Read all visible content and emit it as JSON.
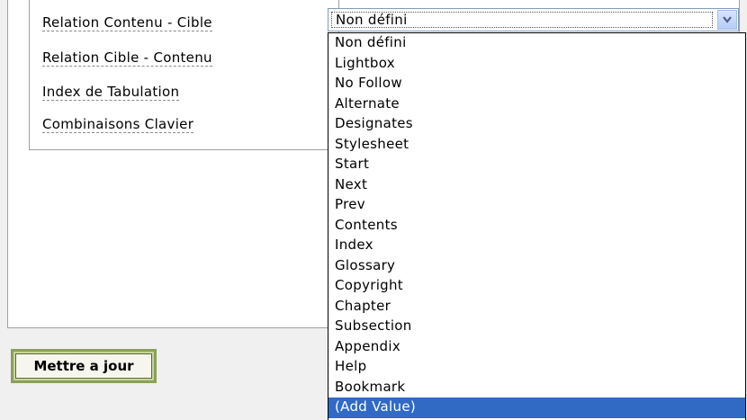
{
  "fields": [
    {
      "label": "Relation Contenu - Cible"
    },
    {
      "label": "Relation Cible - Contenu"
    },
    {
      "label": "Index de Tabulation"
    },
    {
      "label": "Combinaisons Clavier"
    }
  ],
  "select": {
    "value": "Non défini",
    "arrow_icon": "chevron-down-icon",
    "options": [
      "Non défini",
      "Lightbox",
      "No Follow",
      "Alternate",
      "Designates",
      "Stylesheet",
      "Start",
      "Next",
      "Prev",
      "Contents",
      "Index",
      "Glossary",
      "Copyright",
      "Chapter",
      "Subsection",
      "Appendix",
      "Help",
      "Bookmark",
      "(Add Value)"
    ],
    "highlighted_option": "(Add Value)"
  },
  "update_button": {
    "label": "Mettre a jour"
  },
  "colors": {
    "highlight": "#316ac5",
    "button_border": "#8aa05a",
    "panel_border": "#a0a0a0"
  }
}
